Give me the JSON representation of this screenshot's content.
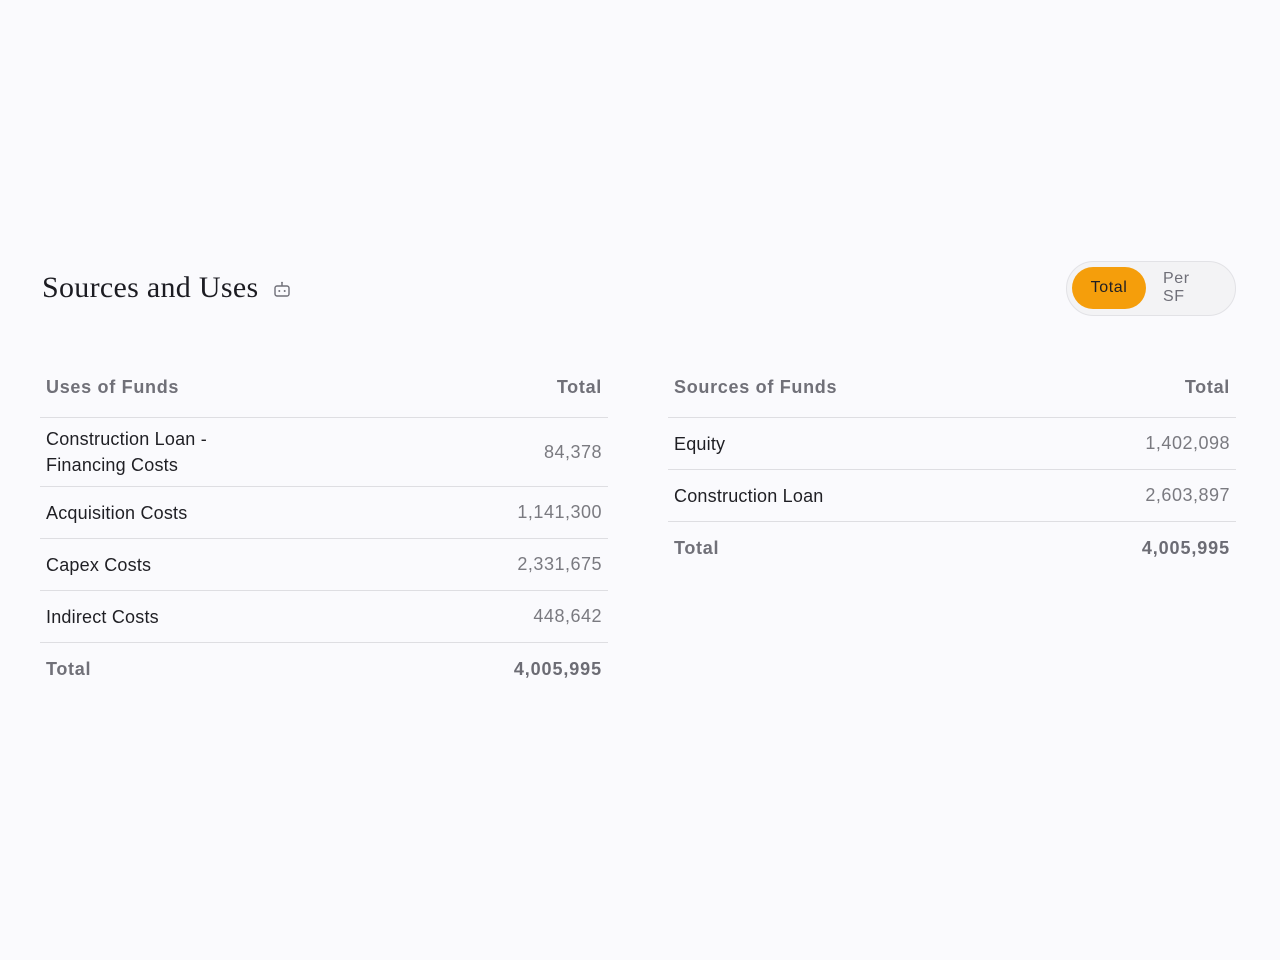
{
  "header": {
    "title": "Sources and Uses",
    "icon": "robot-icon"
  },
  "toggle": {
    "options": [
      "Total",
      "Per SF"
    ],
    "selected": "Total",
    "accent_color": "#f59e0b"
  },
  "uses": {
    "header_label": "Uses of Funds",
    "header_value": "Total",
    "rows": [
      {
        "label": "Construction Loan - Financing Costs",
        "value": "84,378"
      },
      {
        "label": "Acquisition Costs",
        "value": "1,141,300"
      },
      {
        "label": "Capex Costs",
        "value": "2,331,675"
      },
      {
        "label": "Indirect Costs",
        "value": "448,642"
      }
    ],
    "total_label": "Total",
    "total_value": "4,005,995"
  },
  "sources": {
    "header_label": "Sources of Funds",
    "header_value": "Total",
    "rows": [
      {
        "label": "Equity",
        "value": "1,402,098"
      },
      {
        "label": "Construction Loan",
        "value": "2,603,897"
      }
    ],
    "total_label": "Total",
    "total_value": "4,005,995"
  }
}
